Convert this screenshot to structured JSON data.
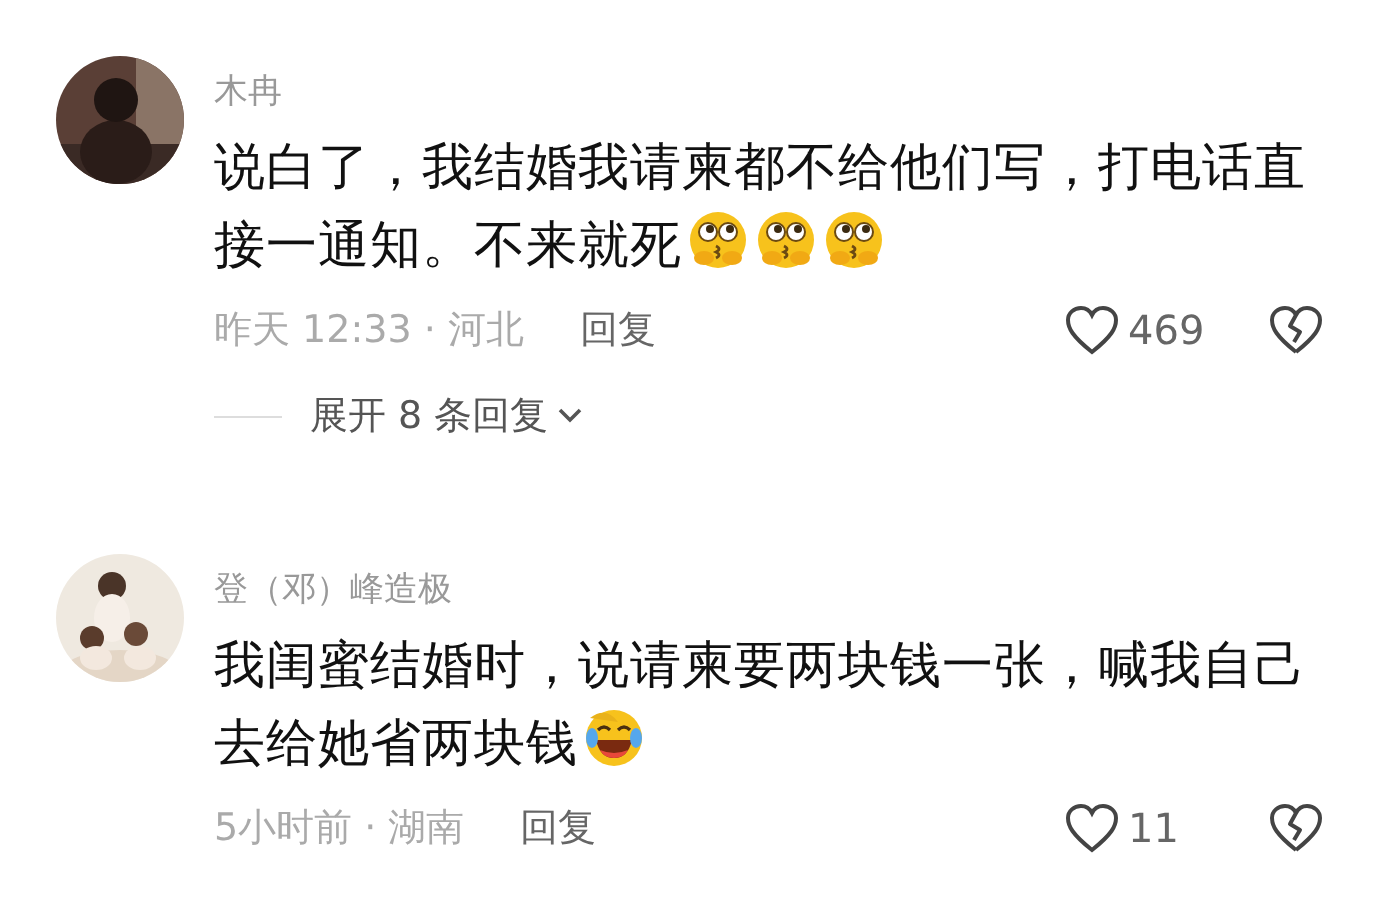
{
  "comments": [
    {
      "author": "木冉",
      "text": "说白了，我结婚我请柬都不给他们写，打电话直接一通知。不来就死",
      "emojis": [
        {
          "kind": "thinking"
        },
        {
          "kind": "thinking"
        },
        {
          "kind": "thinking"
        }
      ],
      "meta": "昨天 12:33 · 河北",
      "reply": "回复",
      "likes": "469",
      "more_replies": "展开 8 条回复"
    },
    {
      "author": "登（邓）峰造极",
      "text": "我闺蜜结婚时，说请柬要两块钱一张，喊我自己去给她省两块钱",
      "emojis": [
        {
          "kind": "crying-laughing"
        }
      ],
      "meta": "5小时前 · 湖南",
      "reply": "回复",
      "likes": "11"
    }
  ]
}
